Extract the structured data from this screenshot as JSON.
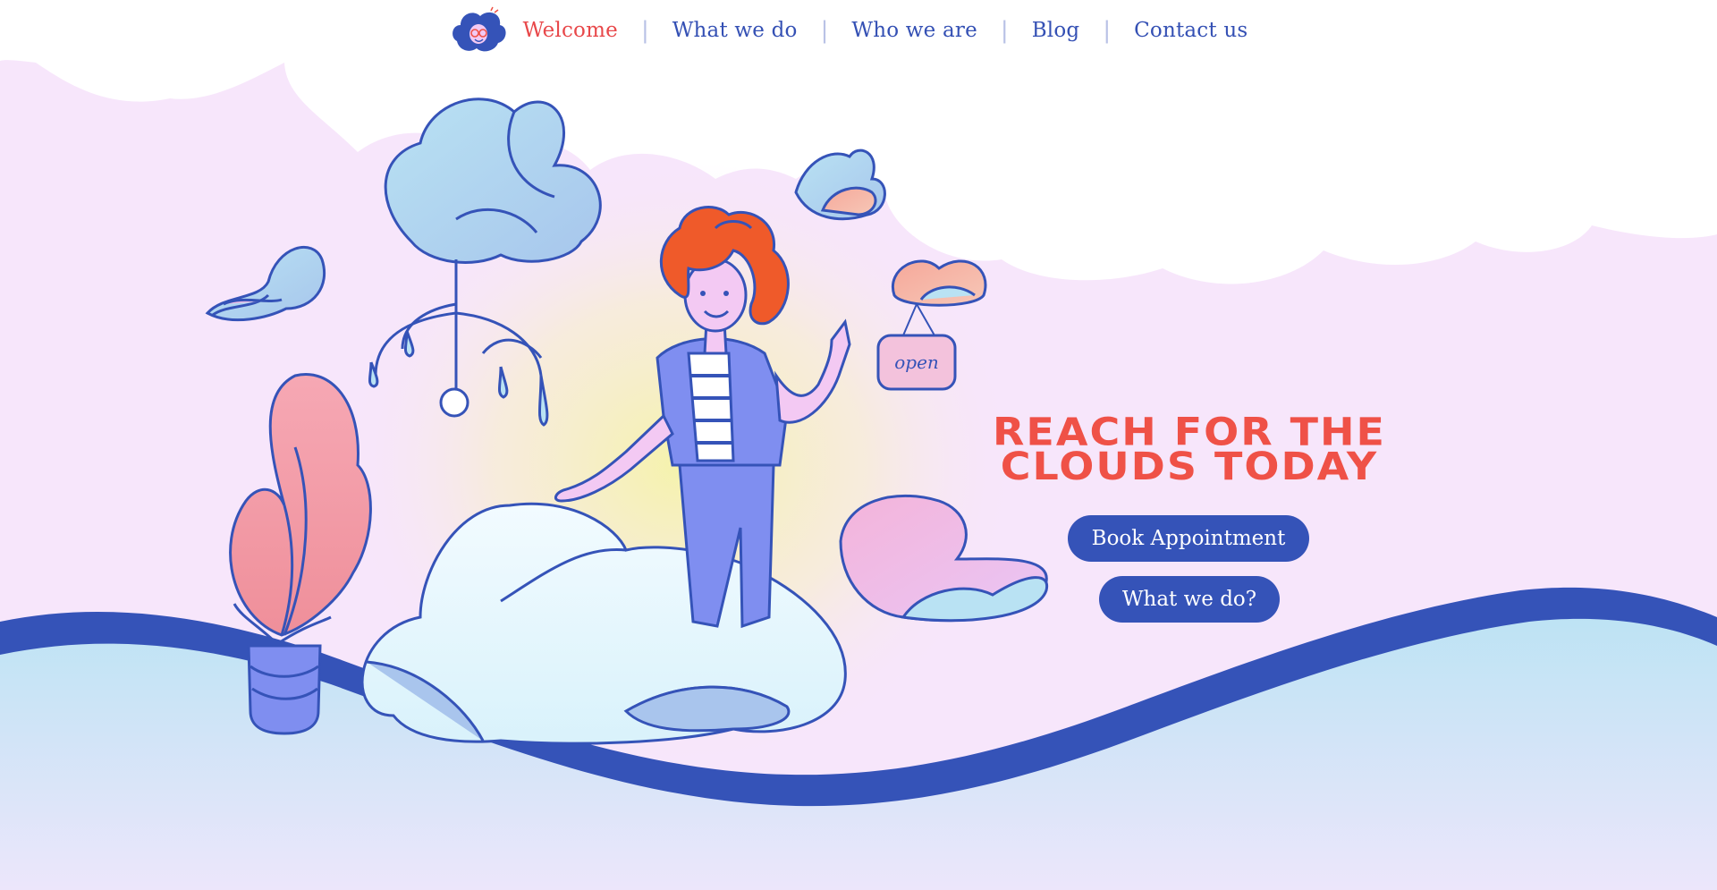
{
  "nav": {
    "logo_icon": "cloud-lady-logo-icon",
    "items": [
      {
        "label": "Welcome",
        "active": true
      },
      {
        "label": "What we do",
        "active": false
      },
      {
        "label": "Who we are",
        "active": false
      },
      {
        "label": "Blog",
        "active": false
      },
      {
        "label": "Contact us",
        "active": false
      }
    ],
    "separator": "|"
  },
  "hero": {
    "title_line1": "REACH FOR THE",
    "title_line2": "CLOUDS TODAY",
    "book_button": "Book Appointment",
    "what_button": "What we do?",
    "sign_text": "open"
  },
  "colors": {
    "accent_red": "#ef5147",
    "brand_blue": "#3553b8",
    "pink_bg": "#f7e6fb",
    "sky_blue": "#bfe2f4"
  }
}
